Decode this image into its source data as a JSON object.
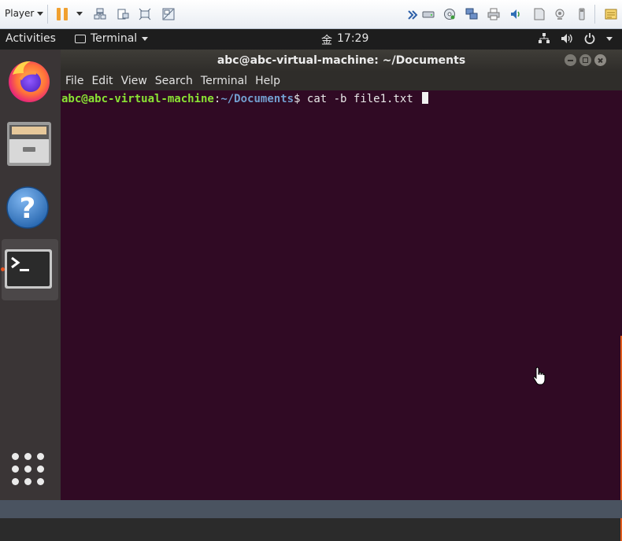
{
  "vm_toolbar": {
    "player_label": "Player",
    "icons": [
      "pause-icon",
      "send-ctrl-alt-del-icon",
      "snapshot-icon",
      "fullscreen-icon",
      "unity-icon",
      "forward-icon",
      "hard-disk-icon",
      "cd-drive-icon",
      "network-adapter-icon",
      "printer-icon",
      "sound-card-icon",
      "floppy-icon",
      "camera-icon",
      "usb-icon",
      "message-log-icon"
    ]
  },
  "topbar": {
    "activities": "Activities",
    "app_name": "Terminal",
    "clock_day": "金",
    "clock_time": "17:29"
  },
  "dock": {
    "items": [
      "firefox",
      "files",
      "help",
      "terminal"
    ],
    "active": "terminal"
  },
  "terminal": {
    "title": "abc@abc-virtual-machine: ~/Documents",
    "menu": [
      "File",
      "Edit",
      "View",
      "Search",
      "Terminal",
      "Help"
    ],
    "prompt_user": "abc@abc-virtual-machine",
    "prompt_sep": ":",
    "prompt_path": "~/Documents",
    "prompt_symbol": "$ ",
    "command": "cat -b file1.txt "
  },
  "colors": {
    "terminal_bg": "#300a24",
    "prompt_user": "#8ae234",
    "prompt_path": "#729fcf",
    "ubuntu_orange": "#e95420"
  }
}
